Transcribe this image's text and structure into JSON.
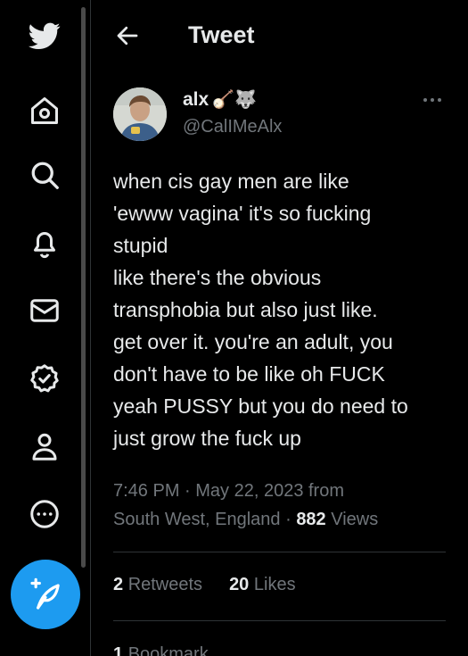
{
  "nav": {
    "items": [
      {
        "icon": "twitter-bird-icon"
      },
      {
        "icon": "home-icon"
      },
      {
        "icon": "search-icon"
      },
      {
        "icon": "bell-icon"
      },
      {
        "icon": "mail-icon"
      },
      {
        "icon": "verified-badge-icon"
      },
      {
        "icon": "person-icon"
      },
      {
        "icon": "more-circle-icon"
      }
    ],
    "compose_icon": "feather-plus-icon",
    "accent": "#1d9bf0"
  },
  "header": {
    "title": "Tweet",
    "back_icon": "arrow-left-icon"
  },
  "author": {
    "name": "alx",
    "emojis": "🪕🐺",
    "handle": "@CalIMeAlx"
  },
  "tweet": {
    "text": "when cis gay men are like\n'ewww vagina' it's so fucking\nstupid\nlike there's the obvious\ntransphobia but also just like.\nget over it. you're an adult, you\ndon't have to be like oh FUCK\nyeah PUSSY but you do need to\njust grow the fuck up",
    "time": "7:46 PM · May 22, 2023 from",
    "location": "South West, England · ",
    "views_count": "882",
    "views_label": "Views"
  },
  "stats": {
    "retweets_count": "2",
    "retweets_label": "Retweets",
    "likes_count": "20",
    "likes_label": "Likes"
  },
  "bookmarks": {
    "count": "1",
    "label": "Bookmark"
  }
}
